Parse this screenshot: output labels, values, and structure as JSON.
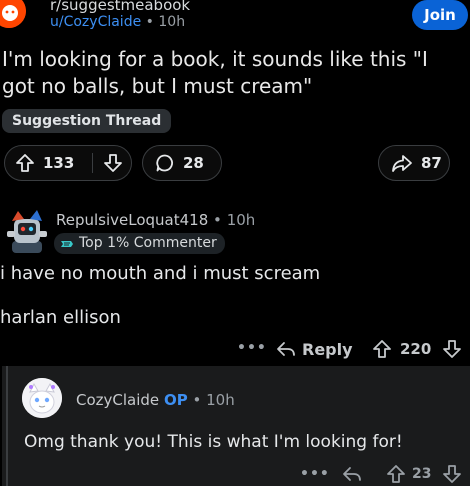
{
  "post": {
    "subreddit": "r/suggestmeabook",
    "author": "u/CozyClaide",
    "separator": "•",
    "age": "10h",
    "join_label": "Join",
    "title": "I'm looking for a book, it sounds like this \"I got no balls, but I must cream\"",
    "flair": "Suggestion Thread",
    "upvotes": "133",
    "comments": "28",
    "shares": "87"
  },
  "comment": {
    "author": "RepulsiveLoquat418",
    "separator": "•",
    "age": "10h",
    "badge": "Top 1% Commenter",
    "line1": "i have no mouth and i must scream",
    "line2": "harlan ellison",
    "more": "•••",
    "reply_label": "Reply",
    "votes": "220"
  },
  "reply": {
    "author": "CozyClaide",
    "op_tag": "OP",
    "separator": "•",
    "age": "10h",
    "body": "Omg thank you! This is what I'm looking for!",
    "more": "•••",
    "votes": "23"
  },
  "colors": {
    "accent_blue": "#3d8ff2",
    "join_blue": "#0a63d6",
    "subreddit_orange": "#ff4500",
    "badge_teal": "#38c8c8"
  }
}
